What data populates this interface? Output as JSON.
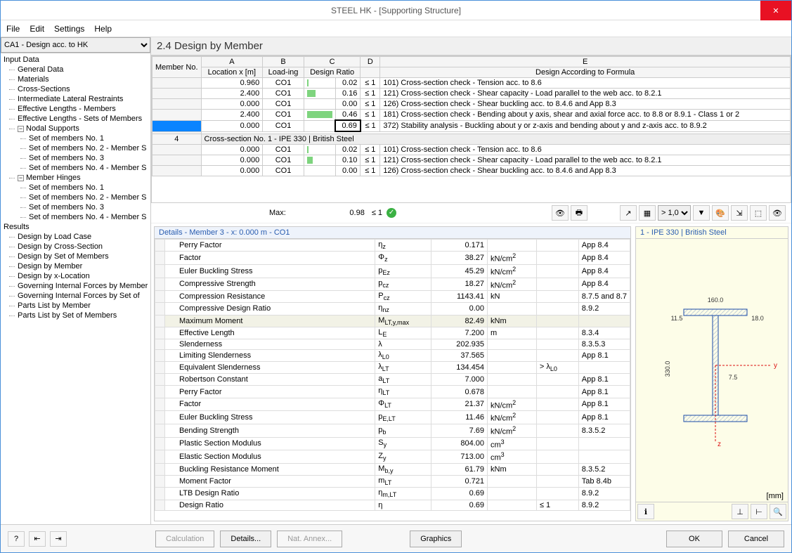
{
  "window": {
    "title": "STEEL HK - [Supporting Structure]"
  },
  "menu": [
    "File",
    "Edit",
    "Settings",
    "Help"
  ],
  "case_select": "CA1 - Design acc. to HK",
  "tree": {
    "input": {
      "label": "Input Data",
      "items": [
        "General Data",
        "Materials",
        "Cross-Sections",
        "Intermediate Lateral Restraints",
        "Effective Lengths - Members",
        "Effective Lengths - Sets of Members"
      ]
    },
    "nodal": {
      "label": "Nodal Supports",
      "items": [
        "Set of members No. 1",
        "Set of members No. 2 - Member S",
        "Set of members No. 3",
        "Set of members No. 4 - Member S"
      ]
    },
    "hinges": {
      "label": "Member Hinges",
      "items": [
        "Set of members No. 1",
        "Set of members No. 2 - Member S",
        "Set of members No. 3",
        "Set of members No. 4 - Member S"
      ]
    },
    "results": {
      "label": "Results",
      "items": [
        "Design by Load Case",
        "Design by Cross-Section",
        "Design by Set of Members",
        "Design by Member",
        "Design by x-Location",
        "Governing Internal Forces by Member",
        "Governing Internal Forces by Set of",
        "Parts List by Member",
        "Parts List by Set of Members"
      ]
    }
  },
  "main_title": "2.4 Design by Member",
  "grid": {
    "cols": {
      "A": "A",
      "B": "B",
      "C": "C",
      "D": "D",
      "E": "E"
    },
    "head": {
      "member": "Member No.",
      "loc": "Location x [m]",
      "load": "Load-ing",
      "ratio": "Design Ratio",
      "formula": "Design According to Formula"
    },
    "rows1": [
      {
        "x": "0.960",
        "ld": "CO1",
        "ratio": "0.02",
        "bar": 2,
        "chk": "≤ 1",
        "desc": "101) Cross-section check - Tension acc. to 8.6"
      },
      {
        "x": "2.400",
        "ld": "CO1",
        "ratio": "0.16",
        "bar": 12,
        "chk": "≤ 1",
        "desc": "121) Cross-section check - Shear capacity - Load parallel to the web acc. to 8.2.1"
      },
      {
        "x": "0.000",
        "ld": "CO1",
        "ratio": "0.00",
        "bar": 0,
        "chk": "≤ 1",
        "desc": "126) Cross-section check - Shear buckling acc. to 8.4.6 and App 8.3"
      },
      {
        "x": "2.400",
        "ld": "CO1",
        "ratio": "0.46",
        "bar": 36,
        "chk": "≤ 1",
        "desc": "181) Cross-section check - Bending about y axis, shear and axial force acc. to 8.8 or  8.9.1 - Class 1 or 2"
      },
      {
        "x": "0.000",
        "ld": "CO1",
        "ratio": "0.69",
        "bar": 0,
        "chk": "≤ 1",
        "desc": "372) Stability analysis - Buckling about y or z-axis and bending about y and z-axis acc. to 8.9.2",
        "selected": true
      }
    ],
    "section_row": {
      "num": "4",
      "text": "Cross-section No.  1 - IPE 330 | British Steel"
    },
    "rows2": [
      {
        "x": "0.000",
        "ld": "CO1",
        "ratio": "0.02",
        "bar": 2,
        "chk": "≤ 1",
        "desc": "101) Cross-section check - Tension acc. to 8.6"
      },
      {
        "x": "0.000",
        "ld": "CO1",
        "ratio": "0.10",
        "bar": 8,
        "chk": "≤ 1",
        "desc": "121) Cross-section check - Shear capacity - Load parallel to the web acc. to 8.2.1"
      },
      {
        "x": "0.000",
        "ld": "CO1",
        "ratio": "0.00",
        "bar": 0,
        "chk": "≤ 1",
        "desc": "126) Cross-section check - Shear buckling acc. to 8.4.6 and App 8.3"
      }
    ]
  },
  "max": {
    "label": "Max:",
    "value": "0.98",
    "chk": "≤ 1"
  },
  "ratio_filter": "> 1,0",
  "details": {
    "header": "Details - Member 3 - x: 0.000 m - CO1",
    "rows": [
      {
        "n": "Perry Factor",
        "s": "η<sub>z</sub>",
        "v": "0.171",
        "u": "",
        "c": "",
        "r": "App 8.4"
      },
      {
        "n": "Factor",
        "s": "Φ<sub>z</sub>",
        "v": "38.27",
        "u": "kN/cm<sup>2</sup>",
        "c": "",
        "r": "App 8.4"
      },
      {
        "n": "Euler Buckling Stress",
        "s": "p<sub>Ez</sub>",
        "v": "45.29",
        "u": "kN/cm<sup>2</sup>",
        "c": "",
        "r": "App 8.4"
      },
      {
        "n": "Compressive Strength",
        "s": "p<sub>cz</sub>",
        "v": "18.27",
        "u": "kN/cm<sup>2</sup>",
        "c": "",
        "r": "App 8.4"
      },
      {
        "n": "Compression Resistance",
        "s": "P<sub>cz</sub>",
        "v": "1143.41",
        "u": "kN",
        "c": "",
        "r": "8.7.5 and 8.7"
      },
      {
        "n": "Compressive Design Ratio",
        "s": "η<sub>nz</sub>",
        "v": "0.00",
        "u": "",
        "c": "",
        "r": "8.9.2"
      },
      {
        "n": "Maximum Moment",
        "s": "M<sub>LT,y,max</sub>",
        "v": "82.49",
        "u": "kNm",
        "c": "",
        "r": "",
        "hl": true
      },
      {
        "n": "Effective Length",
        "s": "L<sub>E</sub>",
        "v": "7.200",
        "u": "m",
        "c": "",
        "r": "8.3.4"
      },
      {
        "n": "Slenderness",
        "s": "λ",
        "v": "202.935",
        "u": "",
        "c": "",
        "r": "8.3.5.3"
      },
      {
        "n": "Limiting Slenderness",
        "s": "λ<sub>L0</sub>",
        "v": "37.565",
        "u": "",
        "c": "",
        "r": "App 8.1"
      },
      {
        "n": "Equivalent Slenderness",
        "s": "λ<sub>LT</sub>",
        "v": "134.454",
        "u": "",
        "c": "> λ<sub>L0</sub>",
        "r": ""
      },
      {
        "n": "Robertson Constant",
        "s": "a<sub>LT</sub>",
        "v": "7.000",
        "u": "",
        "c": "",
        "r": "App 8.1"
      },
      {
        "n": "Perry Factor",
        "s": "η<sub>LT</sub>",
        "v": "0.678",
        "u": "",
        "c": "",
        "r": "App 8.1"
      },
      {
        "n": "Factor",
        "s": "Φ<sub>LT</sub>",
        "v": "21.37",
        "u": "kN/cm<sup>2</sup>",
        "c": "",
        "r": "App 8.1"
      },
      {
        "n": "Euler Buckling Stress",
        "s": "p<sub>E,LT</sub>",
        "v": "11.46",
        "u": "kN/cm<sup>2</sup>",
        "c": "",
        "r": "App 8.1"
      },
      {
        "n": "Bending Strength",
        "s": "p<sub>b</sub>",
        "v": "7.69",
        "u": "kN/cm<sup>2</sup>",
        "c": "",
        "r": "8.3.5.2"
      },
      {
        "n": "Plastic Section Modulus",
        "s": "S<sub>y</sub>",
        "v": "804.00",
        "u": "cm<sup>3</sup>",
        "c": "",
        "r": ""
      },
      {
        "n": "Elastic Section Modulus",
        "s": "Z<sub>y</sub>",
        "v": "713.00",
        "u": "cm<sup>3</sup>",
        "c": "",
        "r": ""
      },
      {
        "n": "Buckling Resistance Moment",
        "s": "M<sub>b,y</sub>",
        "v": "61.79",
        "u": "kNm",
        "c": "",
        "r": "8.3.5.2"
      },
      {
        "n": "Moment Factor",
        "s": "m<sub>LT</sub>",
        "v": "0.721",
        "u": "",
        "c": "",
        "r": "Tab 8.4b"
      },
      {
        "n": "LTB Design Ratio",
        "s": "η<sub>m,LT</sub>",
        "v": "0.69",
        "u": "",
        "c": "",
        "r": "8.9.2"
      },
      {
        "n": "Design Ratio",
        "s": "η",
        "v": "0.69",
        "u": "",
        "c": "≤ 1",
        "r": "8.9.2"
      }
    ]
  },
  "section": {
    "title": "1 - IPE 330 | British Steel",
    "dims": {
      "w": "160.0",
      "h": "330.0",
      "tf": "11.5",
      "tw": "7.5",
      "r": "18.0"
    },
    "unit": "[mm]"
  },
  "buttons": {
    "calc": "Calculation",
    "details": "Details...",
    "annex": "Nat. Annex...",
    "graphics": "Graphics",
    "ok": "OK",
    "cancel": "Cancel"
  }
}
